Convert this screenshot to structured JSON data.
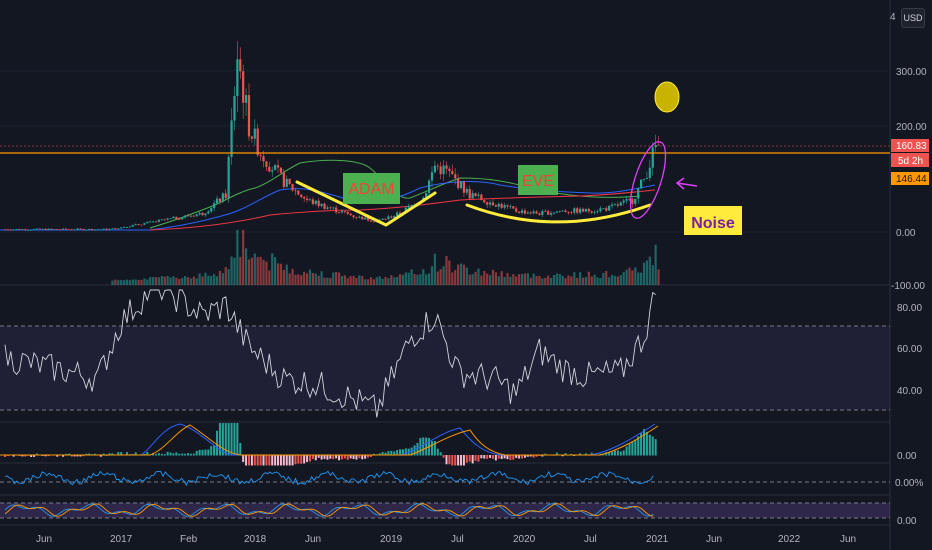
{
  "currency_button": "USD",
  "top_scale_label": "4",
  "price_axis": {
    "ticks": [
      "300.00",
      "200.00",
      "0.00",
      "-100.00"
    ]
  },
  "price_tags": {
    "last_price": "160.83",
    "countdown": "5d 2h",
    "secondary_price": "146.44"
  },
  "annotations": {
    "adam": "ADAM",
    "eve": "EVE",
    "noise": "Noise"
  },
  "rsi_axis": {
    "ticks": [
      "80.00",
      "60.00",
      "40.00"
    ]
  },
  "macd_axis": {
    "ticks": [
      "0.00"
    ]
  },
  "pct_axis": {
    "ticks": [
      "0.00%"
    ]
  },
  "stoch_axis": {
    "ticks": [
      "0.00"
    ]
  },
  "time_axis": {
    "labels": [
      "Jun",
      "2017",
      "Feb",
      "2018",
      "Jun",
      "2019",
      "Jul",
      "2020",
      "Jul",
      "2021",
      "Jun",
      "2022",
      "Jun"
    ]
  },
  "colors": {
    "background": "#131722",
    "up": "#26a69a",
    "down": "#ef5350",
    "resistance_line": "#ff9800",
    "annotation_box": "#4caf50",
    "annotation_text": "#f44336",
    "yellow_curve": "#ffeb3b",
    "magenta": "#e040fb",
    "rsi_band": "#7e57c2"
  },
  "chart_data": [
    {
      "type": "candlestick",
      "pane": "price",
      "x_range": [
        "2016-05",
        "2022-09"
      ],
      "ylim": [
        -100,
        400
      ],
      "price_series": {
        "name": "",
        "x": [
          "2016-06",
          "2016-10",
          "2017-02",
          "2017-06",
          "2017-10",
          "2017-12",
          "2018-01",
          "2018-02",
          "2018-03",
          "2018-05",
          "2018-07",
          "2018-09",
          "2018-11",
          "2019-01",
          "2019-03",
          "2019-05",
          "2019-06",
          "2019-07",
          "2019-09",
          "2019-11",
          "2020-01",
          "2020-03",
          "2020-05",
          "2020-07",
          "2020-09",
          "2020-11",
          "2020-12",
          "2021-01"
        ],
        "values": [
          5,
          5,
          5,
          20,
          35,
          70,
          330,
          200,
          150,
          95,
          60,
          45,
          30,
          20,
          35,
          65,
          125,
          115,
          70,
          55,
          40,
          35,
          40,
          40,
          45,
          60,
          100,
          160.83
        ]
      },
      "horizontal_lines": [
        160.83,
        146.44
      ]
    },
    {
      "type": "line",
      "pane": "rsi",
      "ylim": [
        20,
        90
      ],
      "guide_levels": [
        70,
        30
      ],
      "series": [
        {
          "name": "",
          "x": [
            "2016-05",
            "2016-09",
            "2017-01",
            "2017-03",
            "2017-06",
            "2017-10",
            "2017-12",
            "2018-02",
            "2018-05",
            "2018-08",
            "2018-11",
            "2019-01",
            "2019-04",
            "2019-06",
            "2019-08",
            "2019-11",
            "2020-01",
            "2020-03",
            "2020-05",
            "2020-07",
            "2020-10",
            "2020-12",
            "2021-01"
          ],
          "values": [
            55,
            50,
            45,
            72,
            90,
            75,
            80,
            60,
            45,
            42,
            35,
            30,
            65,
            75,
            48,
            45,
            38,
            58,
            50,
            46,
            48,
            65,
            86
          ]
        }
      ]
    }
  ]
}
